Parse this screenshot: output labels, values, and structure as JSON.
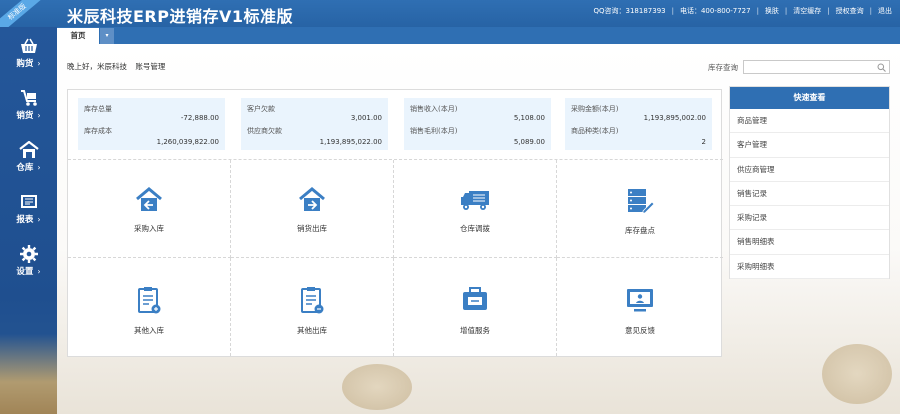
{
  "header": {
    "title": "米辰科技ERP进销存V1标准版",
    "ribbon": "标准版",
    "links": [
      "QQ咨询：318187393",
      "电话：400-800-7727",
      "换肤",
      "清空缓存",
      "授权查询",
      "退出"
    ]
  },
  "sidebar": {
    "items": [
      {
        "label": "购货",
        "icon": "basket-icon"
      },
      {
        "label": "销货",
        "icon": "cart-icon"
      },
      {
        "label": "仓库",
        "icon": "house-icon"
      },
      {
        "label": "报表",
        "icon": "report-icon"
      },
      {
        "label": "设置",
        "icon": "gear-icon"
      }
    ]
  },
  "tabs": {
    "home": "首页",
    "dropdown": "▾"
  },
  "greeting": {
    "text": "晚上好，米辰科技",
    "account_link": "账号管理"
  },
  "stock_query": {
    "label": "库存查询",
    "placeholder": ""
  },
  "stats": [
    {
      "k1": "库存总量",
      "v1": "-72,888.00",
      "k2": "库存成本",
      "v2": "1,260,039,822.00"
    },
    {
      "k1": "客户欠款",
      "v1": "3,001.00",
      "k2": "供应商欠款",
      "v2": "1,193,895,022.00"
    },
    {
      "k1": "销售收入(本月)",
      "v1": "5,108.00",
      "k2": "销售毛利(本月)",
      "v2": "5,089.00"
    },
    {
      "k1": "采购金额(本月)",
      "v1": "1,193,895,002.00",
      "k2": "商品种类(本月)",
      "v2": "2"
    }
  ],
  "shortcuts": [
    {
      "label": "采购入库",
      "icon": "purchase-in-icon"
    },
    {
      "label": "销货出库",
      "icon": "sales-out-icon"
    },
    {
      "label": "仓库调拨",
      "icon": "truck-icon"
    },
    {
      "label": "库存盘点",
      "icon": "inventory-check-icon"
    },
    {
      "label": "其他入库",
      "icon": "other-in-icon"
    },
    {
      "label": "其他出库",
      "icon": "other-out-icon"
    },
    {
      "label": "增值服务",
      "icon": "service-icon"
    },
    {
      "label": "意见反馈",
      "icon": "feedback-icon"
    }
  ],
  "quick_view": {
    "title": "快速查看",
    "items": [
      "商品管理",
      "客户管理",
      "供应商管理",
      "销售记录",
      "采购记录",
      "销售明细表",
      "采购明细表"
    ]
  },
  "colors": {
    "primary": "#2f6fb3",
    "sidebar": "#24579a",
    "card_bg": "#eaf4fd",
    "icon": "#3b7fc4"
  }
}
